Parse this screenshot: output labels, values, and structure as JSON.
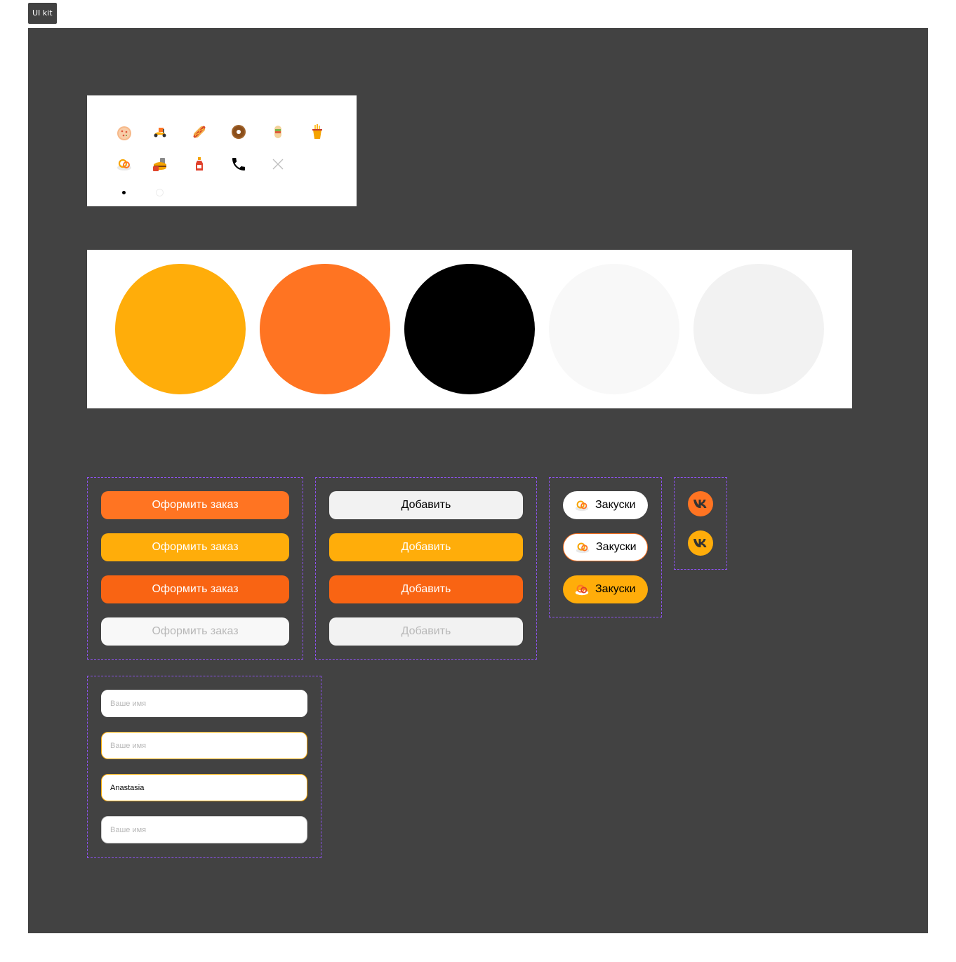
{
  "frame": {
    "label": "UI kit"
  },
  "icons": {
    "row1": [
      "pizza-icon",
      "scooter-icon",
      "hotdog-icon",
      "donut-icon",
      "burrito-icon",
      "fries-icon"
    ],
    "row2": [
      "snacks-icon",
      "combo-icon",
      "sauce-icon",
      "phone-icon",
      "close-icon"
    ],
    "dots": [
      "active",
      "inactive"
    ]
  },
  "palette": {
    "colors": [
      "#FFAD0A",
      "#FF7422",
      "#000000",
      "#F8F8F8",
      "#F2F2F2"
    ]
  },
  "order_buttons": {
    "label": "Оформить заказ",
    "states": [
      "default",
      "hover",
      "active",
      "disabled"
    ],
    "colors": [
      "#FF7422",
      "#FFAD0A",
      "#F96413",
      "#F8F8F8"
    ]
  },
  "add_buttons": {
    "label": "Добавить",
    "states": [
      "default",
      "hover",
      "active",
      "disabled"
    ],
    "colors": [
      "#F2F2F2",
      "#FFAD0A",
      "#F96413",
      "#F2F2F2"
    ]
  },
  "category_pills": {
    "label": "Закуски",
    "states": [
      "default",
      "hover",
      "active"
    ]
  },
  "social": {
    "vk_colors": [
      "#FF7422",
      "#FFAD0A"
    ]
  },
  "inputs": {
    "placeholder": "Ваше имя",
    "filled_value": "Anastasia"
  }
}
